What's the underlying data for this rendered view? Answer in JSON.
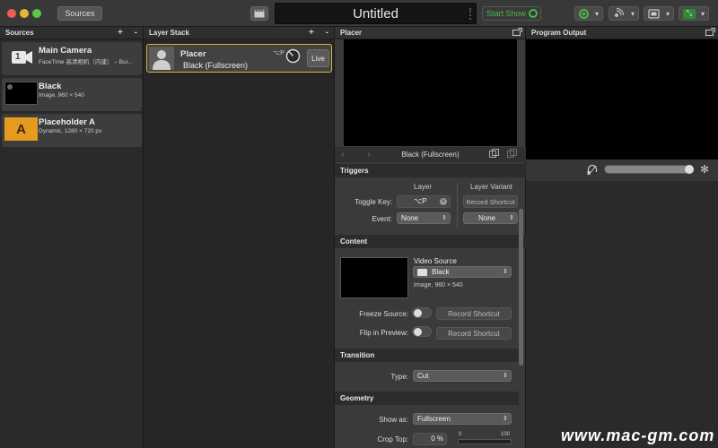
{
  "toolbar": {
    "sources_button": "Sources",
    "document_title": "Untitled",
    "start_show_label": "Start Show",
    "colors": {
      "accent_green": "#47b84a",
      "selection_yellow": "#d4b73c"
    }
  },
  "sources": {
    "header": "Sources",
    "add_label": "+",
    "remove_label": "-",
    "items": [
      {
        "name": "Main Camera",
        "subtitle": "FaceTime 高清相机（内建） – Bui...",
        "thumb_label": "1",
        "icon": "camera-icon"
      },
      {
        "name": "Black",
        "subtitle": "Image, 960 × 540",
        "icon": "image-icon"
      },
      {
        "name": "Placeholder A",
        "subtitle": "Dynamic, 1280 × 720 px",
        "thumb_label": "A",
        "icon": "placeholder-icon"
      }
    ]
  },
  "layer_stack": {
    "header": "Layer Stack",
    "add_label": "+",
    "remove_label": "-",
    "items": [
      {
        "name": "Placer",
        "variant": "Black (Fullscreen)",
        "shortcut": "⌥P",
        "live_label": "Live"
      }
    ]
  },
  "placer": {
    "header": "Placer",
    "preview_caption": "Black (Fullscreen)",
    "triggers": {
      "title": "Triggers",
      "col_layer": "Layer",
      "col_variant": "Layer Variant",
      "toggle_key_label": "Toggle Key:",
      "toggle_key_value": "⌥P",
      "record_shortcut_small": "Record Shortcut",
      "event_label": "Event:",
      "event_value": "None",
      "variant_event_value": "None"
    },
    "content": {
      "title": "Content",
      "video_source_label": "Video Source",
      "video_source_value": "Black",
      "source_info": "Image, 960 × 540",
      "freeze_label": "Freeze Source:",
      "flip_label": "Flip in Preview:",
      "record_shortcut": "Record Shortcut"
    },
    "transition": {
      "title": "Transition",
      "type_label": "Type:",
      "type_value": "Cut"
    },
    "geometry": {
      "title": "Geometry",
      "show_as_label": "Show as:",
      "show_as_value": "Fullscreen",
      "crop_top_label": "Crop Top:",
      "crop_top_value": "0",
      "crop_top_unit": "%",
      "slider_min": "0",
      "slider_max": "100"
    }
  },
  "program_output": {
    "header": "Program Output",
    "volume_level": 1.0
  },
  "watermark": "www.mac-gm.com"
}
